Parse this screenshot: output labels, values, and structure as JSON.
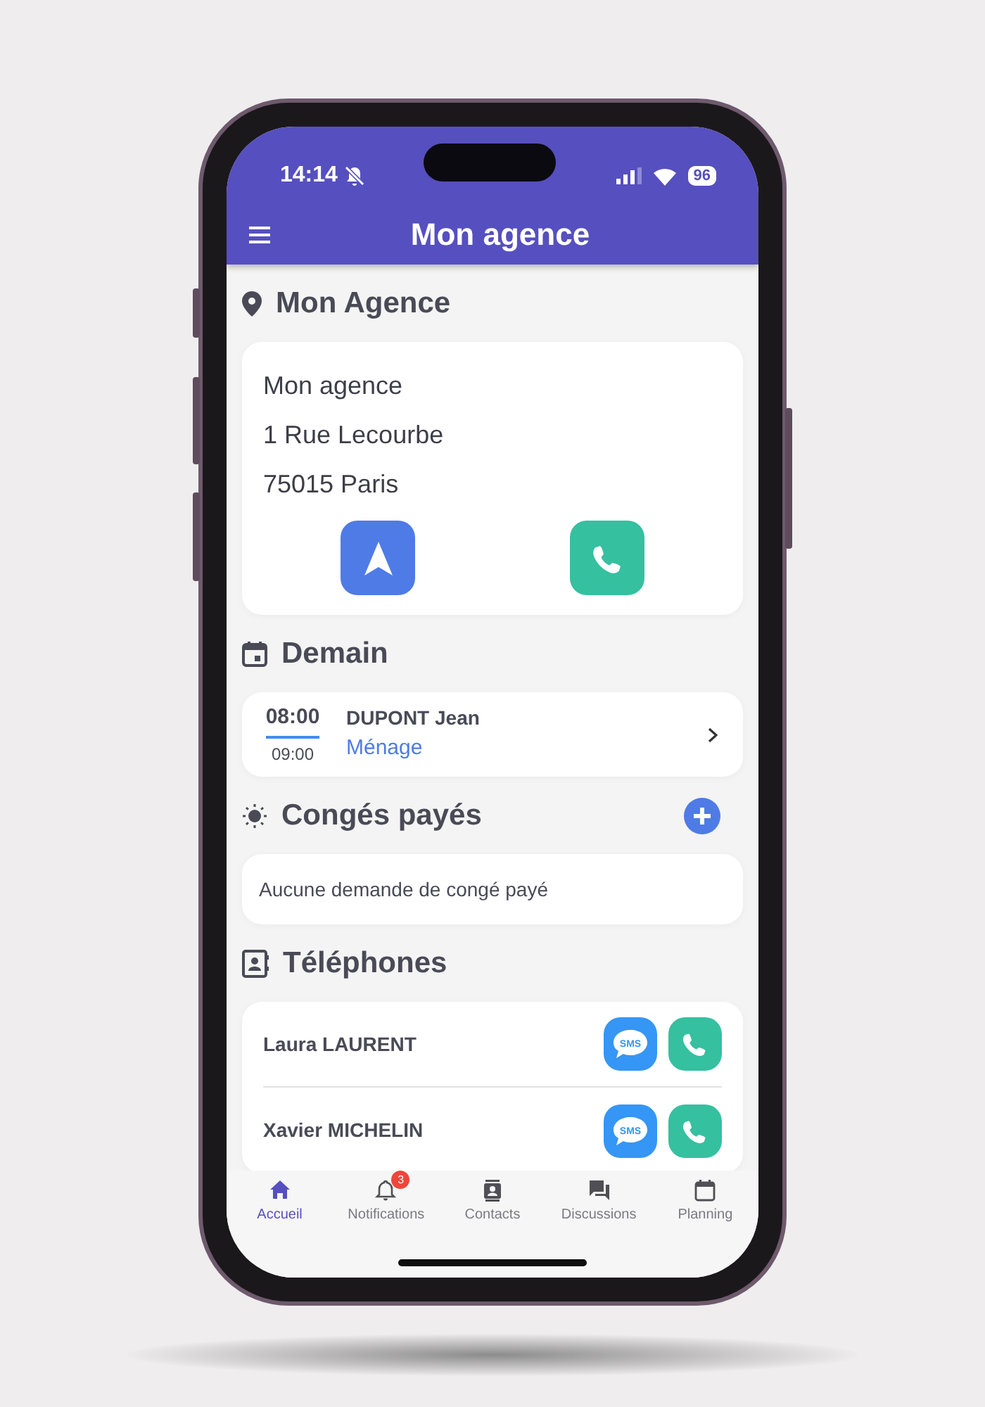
{
  "status_bar": {
    "time": "14:14",
    "silent": true,
    "battery": "96"
  },
  "app_bar": {
    "title": "Mon agence"
  },
  "agency": {
    "heading": "Mon Agence",
    "lines": [
      "Mon agence",
      "1 Rue Lecourbe",
      "75015 Paris"
    ]
  },
  "tomorrow": {
    "heading": "Demain",
    "appointments": [
      {
        "start": "08:00",
        "end": "09:00",
        "client": "DUPONT Jean",
        "service": "Ménage"
      }
    ]
  },
  "paid_leave": {
    "heading": "Congés payés",
    "empty_text": "Aucune demande de congé payé"
  },
  "phones": {
    "heading": "Téléphones",
    "contacts": [
      {
        "name": "Laura LAURENT",
        "sms_label": "SMS"
      },
      {
        "name": "Xavier MICHELIN",
        "sms_label": "SMS"
      }
    ]
  },
  "bottom_nav": [
    {
      "kind": "home",
      "label": "Accueil",
      "selected": true
    },
    {
      "kind": "bell",
      "label": "Notifications",
      "selected": false,
      "badge": "3"
    },
    {
      "kind": "contacts",
      "label": "Contacts",
      "selected": false
    },
    {
      "kind": "chat",
      "label": "Discussions",
      "selected": false
    },
    {
      "kind": "calendar",
      "label": "Planning",
      "selected": false
    }
  ]
}
